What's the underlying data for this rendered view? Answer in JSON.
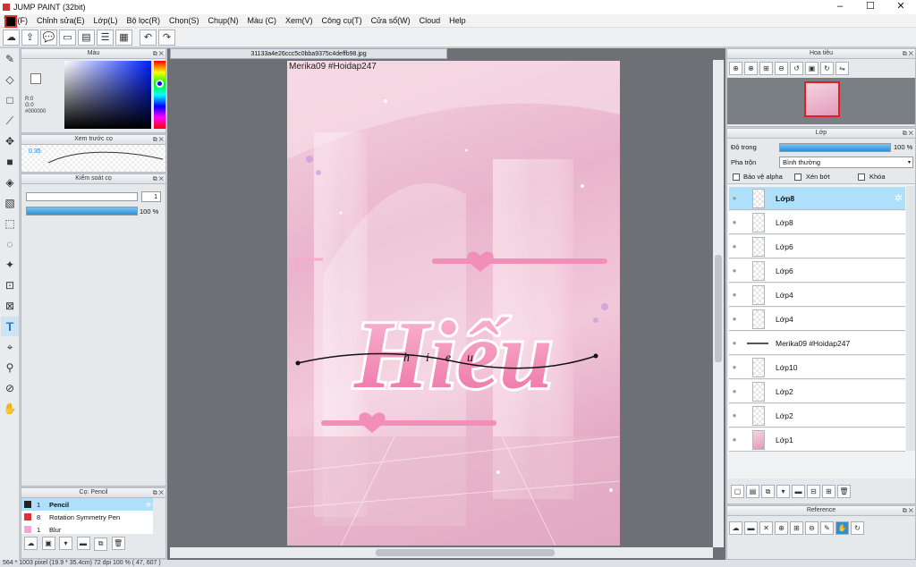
{
  "app": {
    "title": "JUMP PAINT (32bit)"
  },
  "menu": [
    "Tệp(F)",
    "Chỉnh sửa(E)",
    "Lớp(L)",
    "Bộ lọc(R)",
    "Chọn(S)",
    "Chụp(N)",
    "Màu (C)",
    "Xem(V)",
    "Công cụ(T)",
    "Cửa sổ(W)",
    "Cloud",
    "Help"
  ],
  "color_panel": {
    "title": "Màu",
    "r": "R:0",
    "g": "G:0",
    "hex": "#000000",
    "fg": "#000000",
    "bg": "#ffffff"
  },
  "preview_panel": {
    "title": "Xem trước cọ",
    "size": "0.35"
  },
  "control_panel": {
    "title": "Kiểm soát cọ",
    "size_value": "1",
    "opacity_value": "100 %",
    "opacity_fraction": 1.0
  },
  "brush_panel": {
    "title": "Cọ: Pencil",
    "items": [
      {
        "size": "1",
        "name": "Pencil",
        "color": "#222222"
      },
      {
        "size": "8",
        "name": "Rotation Symmetry Pen",
        "color": "#e03030"
      },
      {
        "size": "1",
        "name": "Blur",
        "color": "#f4a6d6"
      }
    ]
  },
  "document": {
    "tab": "31133a4e26ccc5c0bba9375c4deffb98.jpg",
    "canvas_text": "Merika09 #Hoidap247",
    "artwork_title": "Hiếu",
    "artwork_subtitle": "hieu"
  },
  "navigator": {
    "title": "Hoa tiêu"
  },
  "layer_panel": {
    "title": "Lớp",
    "opacity_label": "Độ trong",
    "opacity_value": "100 %",
    "blend_label": "Pha trộn",
    "blend_value": "Bình thường",
    "protect_alpha": "Bảo vệ alpha",
    "clip": "Xén bớt",
    "lock": "Khóa",
    "layers": [
      "Lớp8",
      "Lớp8",
      "Lớp6",
      "Lớp6",
      "Lớp4",
      "Lớp4",
      "Merika09 #Hoidap247",
      "Lớp10",
      "Lớp2",
      "Lớp2",
      "Lớp1"
    ]
  },
  "reference": {
    "title": "Reference"
  },
  "status": {
    "text": "564 * 1003 pixel   (19.9 * 35.4cm)   72 dpi   100 %   ( 47, 607 )"
  }
}
